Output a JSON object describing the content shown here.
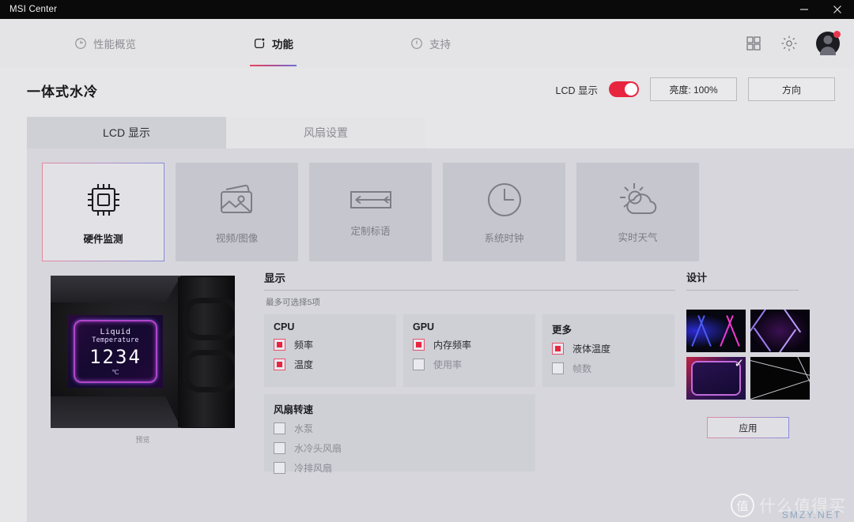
{
  "window": {
    "title": "MSI Center",
    "minimize_icon": "minimize-icon",
    "close_icon": "close-icon"
  },
  "nav": {
    "tabs": [
      {
        "label": "性能概览",
        "icon": "gauge-icon",
        "active": false
      },
      {
        "label": "功能",
        "icon": "feature-icon",
        "active": true
      },
      {
        "label": "支持",
        "icon": "info-icon",
        "active": false
      }
    ],
    "apps_icon": "grid-apps-icon",
    "settings_icon": "gear-icon",
    "avatar_icon": "user-avatar",
    "accent_from": "#e8455e",
    "accent_to": "#6f6fd6"
  },
  "page": {
    "title": "一体式水冷",
    "lcd_toggle_label": "LCD 显示",
    "lcd_toggle_on": true,
    "toggle_color": "#e8253f",
    "brightness_button": "亮度: 100%",
    "orientation_button": "方向"
  },
  "tabs": [
    {
      "label": "LCD 显示",
      "active": true
    },
    {
      "label": "风扇设置",
      "active": false
    }
  ],
  "mode_cards": [
    {
      "label": "硬件监测",
      "icon": "cpu-chip-icon",
      "selected": true
    },
    {
      "label": "视频/图像",
      "icon": "image-stack-icon",
      "selected": false
    },
    {
      "label": "定制标语",
      "icon": "banner-arrows-icon",
      "selected": false
    },
    {
      "label": "系统时钟",
      "icon": "clock-icon",
      "selected": false
    },
    {
      "label": "实时天气",
      "icon": "sun-cloud-icon",
      "selected": false
    }
  ],
  "preview": {
    "caption": "预览",
    "screen_line1": "Liquid",
    "screen_line2": "Temperature",
    "screen_value": "1234",
    "screen_unit": "℃"
  },
  "display_section": {
    "title": "显示",
    "hint": "最多可选择5项",
    "groups": [
      {
        "name": "CPU",
        "items": [
          {
            "label": "频率",
            "checked": true
          },
          {
            "label": "温度",
            "checked": true
          }
        ]
      },
      {
        "name": "GPU",
        "items": [
          {
            "label": "内存频率",
            "checked": true
          },
          {
            "label": "使用率",
            "checked": false
          }
        ]
      },
      {
        "name": "更多",
        "items": [
          {
            "label": "液体温度",
            "checked": true
          },
          {
            "label": "帧数",
            "checked": false
          }
        ]
      }
    ],
    "fan_group": {
      "name": "风扇转速",
      "items": [
        {
          "label": "水泵",
          "checked": false
        },
        {
          "label": "水冷头风扇",
          "checked": false
        },
        {
          "label": "冷排风扇",
          "checked": false
        }
      ]
    }
  },
  "design_section": {
    "title": "设计",
    "thumbnails": [
      {
        "name": "design-neon-arrows",
        "selected": false
      },
      {
        "name": "design-purple-zigzag",
        "selected": false
      },
      {
        "name": "design-red-frame",
        "selected": true
      },
      {
        "name": "design-black-lines",
        "selected": false
      }
    ],
    "apply_button": "应用"
  },
  "watermark": {
    "mark": "值",
    "text": "什么值得买",
    "sub": "SMZY.NET"
  }
}
